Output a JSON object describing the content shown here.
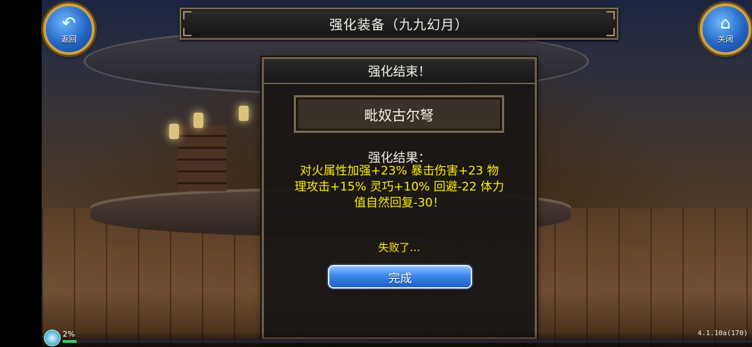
{
  "header": {
    "back_label": "返回",
    "close_label": "关闭",
    "title": "强化装备（九九幻月）"
  },
  "dialog": {
    "title": "强化结束！",
    "item_name": "毗奴古尔弩",
    "result_heading": "强化结果：",
    "result_lines": [
      "对火属性加强+23% 暴击伤害+23 物",
      "理攻击+15% 灵巧+10% 回避-22 体力",
      "值自然回复-30！"
    ],
    "fail_text": "失败了…",
    "done_label": "完成"
  },
  "status": {
    "progress_text": "2%",
    "progress_value": 0.02,
    "version": "4.1.10a(170)"
  },
  "colors": {
    "result_text": "#fff000",
    "button_blue": "#3b86ea",
    "frame_gold": "#c9a24a"
  },
  "icons": {
    "back": "back-arrow-icon",
    "close": "home-icon",
    "progress": "spinner-icon"
  }
}
